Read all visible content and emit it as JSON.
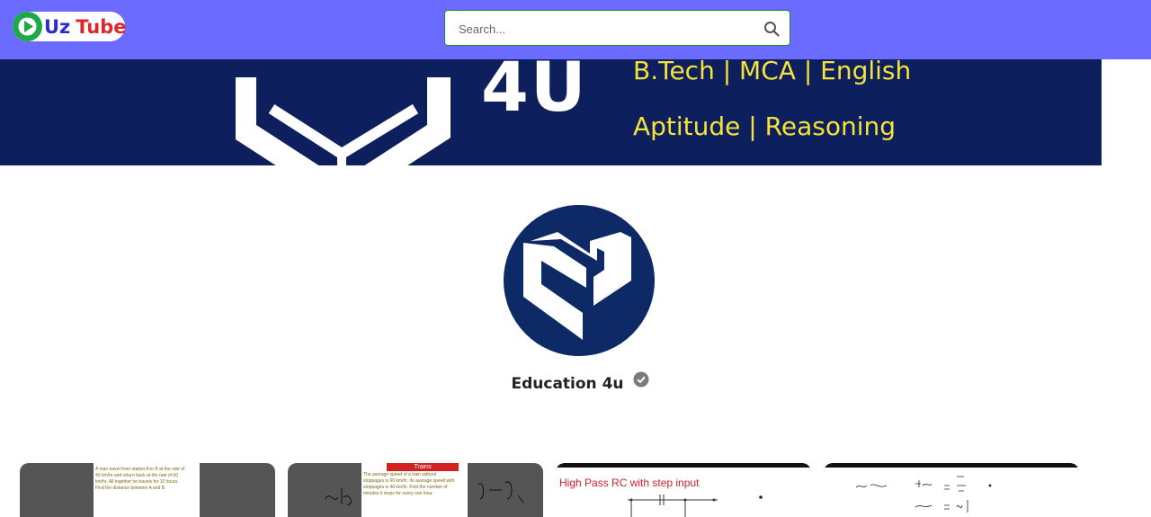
{
  "header": {
    "logo": {
      "part1": "Uz",
      "part2": "Tube"
    },
    "search": {
      "placeholder": "Search..."
    }
  },
  "banner": {
    "brand_suffix": "4U",
    "line1": "B.Tech | MCA | English",
    "line2": "Aptitude | Reasoning"
  },
  "channel": {
    "name": "Education 4u",
    "verified": true
  },
  "videos": [
    {
      "thumb_lines": [
        "A man travel from station A to B at the rate of",
        "40 km/hr and return back at the rate of 60",
        "km/hr. All together he travels for 10 hours.",
        "Find the distance between A and B."
      ]
    },
    {
      "thumb_tag": "Trains",
      "thumb_lines": [
        "The average speed of a train without",
        "stoppages is 60 km/hr. Its average speed with",
        "stoppages is 40 km/hr. Find the number of",
        "minutes it stops for every one hour."
      ]
    },
    {
      "thumb_title": "High Pass RC with step input"
    },
    {
      "thumb_title": ""
    }
  ],
  "colors": {
    "header_bg": "#6b6bff",
    "banner_bg": "#0e1f5e",
    "banner_text": "#f5e23a",
    "avatar_bg": "#0e2a66"
  }
}
